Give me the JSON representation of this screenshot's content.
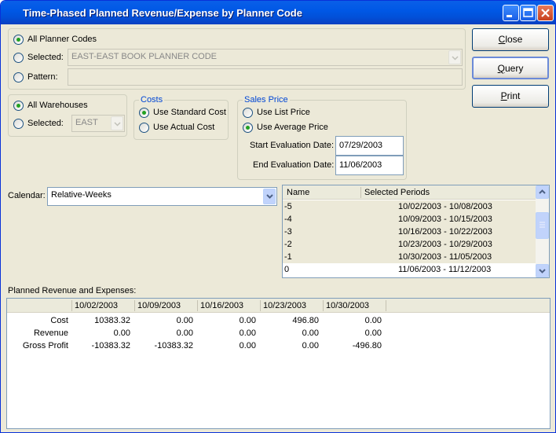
{
  "window": {
    "title": "Time-Phased Planned Revenue/Expense by Planner Code"
  },
  "planner": {
    "all_label": "All Planner Codes",
    "selected_label": "Selected:",
    "selected_value": "EAST-EAST BOOK PLANNER CODE",
    "pattern_label": "Pattern:",
    "pattern_value": ""
  },
  "warehouse": {
    "all_label": "All Warehouses",
    "selected_label": "Selected:",
    "selected_value": "EAST"
  },
  "costs": {
    "legend": "Costs",
    "standard_label": "Use Standard Cost",
    "actual_label": "Use Actual Cost"
  },
  "sales_price": {
    "legend": "Sales Price",
    "list_label": "Use List Price",
    "average_label": "Use Average Price",
    "start_label": "Start Evaluation Date:",
    "start_value": "07/29/2003",
    "end_label": "End Evaluation Date:",
    "end_value": "11/06/2003"
  },
  "buttons": {
    "close": "lose",
    "close_u": "C",
    "query": "uery",
    "query_u": "Q",
    "print": "rint",
    "print_u": "P"
  },
  "calendar": {
    "label": "Calendar:",
    "value": "Relative-Weeks"
  },
  "periods": {
    "col_name": "Name",
    "col_periods": "Selected Periods",
    "rows": [
      {
        "name": "-5",
        "range": "10/02/2003 - 10/08/2003"
      },
      {
        "name": "-4",
        "range": "10/09/2003 - 10/15/2003"
      },
      {
        "name": "-3",
        "range": "10/16/2003 - 10/22/2003"
      },
      {
        "name": "-2",
        "range": "10/23/2003 - 10/29/2003"
      },
      {
        "name": "-1",
        "range": "10/30/2003 - 11/05/2003"
      },
      {
        "name": "0",
        "range": "11/06/2003 - 11/12/2003"
      }
    ]
  },
  "results": {
    "label": "Planned Revenue and Expenses:",
    "columns": [
      "10/02/2003",
      "10/09/2003",
      "10/16/2003",
      "10/23/2003",
      "10/30/2003"
    ],
    "rows": [
      {
        "label": "Cost",
        "values": [
          "10383.32",
          "0.00",
          "0.00",
          "496.80",
          "0.00"
        ]
      },
      {
        "label": "Revenue",
        "values": [
          "0.00",
          "0.00",
          "0.00",
          "0.00",
          "0.00"
        ]
      },
      {
        "label": "Gross Profit",
        "values": [
          "-10383.32",
          "-10383.32",
          "0.00",
          "0.00",
          "-496.80"
        ]
      }
    ]
  }
}
